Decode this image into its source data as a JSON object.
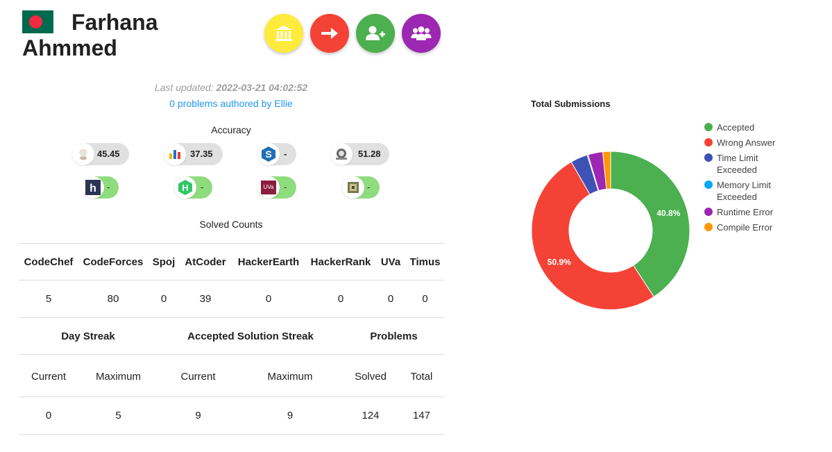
{
  "profile": {
    "first_name": "Farhana",
    "last_name": "Ahmmed",
    "country_flag": "bangladesh-flag"
  },
  "actions": [
    {
      "name": "institution-button",
      "icon": "institution-icon",
      "color": "#ffeb3b"
    },
    {
      "name": "arrow-right-button",
      "icon": "arrow-right-icon",
      "color": "#f44336"
    },
    {
      "name": "add-friend-button",
      "icon": "user-plus-icon",
      "color": "#4caf50"
    },
    {
      "name": "group-button",
      "icon": "users-icon",
      "color": "#9c27b0"
    }
  ],
  "meta": {
    "last_updated_label": "Last updated:",
    "last_updated_value": "2022-03-21 04:02:52",
    "authored_text": "0 problems authored by Ellie"
  },
  "accuracy": {
    "title": "Accuracy",
    "items": [
      {
        "site": "codechef",
        "icon": "codechef-logo-icon",
        "value": "45.45"
      },
      {
        "site": "codeforces",
        "icon": "codeforces-logo-icon",
        "value": "37.35"
      },
      {
        "site": "spoj",
        "icon": "spoj-logo-icon",
        "value": "-"
      },
      {
        "site": "atcoder",
        "icon": "atcoder-logo-icon",
        "value": "51.28"
      },
      {
        "site": "hackerearth",
        "icon": "hackerearth-logo-icon",
        "value": "-"
      },
      {
        "site": "hackerrank",
        "icon": "hackerrank-logo-icon",
        "value": "-"
      },
      {
        "site": "uva",
        "icon": "uva-logo-icon",
        "logo_text": "UVa",
        "value": "-"
      },
      {
        "site": "timus",
        "icon": "timus-logo-icon",
        "value": "-"
      }
    ]
  },
  "solved_counts": {
    "title": "Solved Counts",
    "headers": [
      "CodeChef",
      "CodeForces",
      "Spoj",
      "AtCoder",
      "HackerEarth",
      "HackerRank",
      "UVa",
      "Timus"
    ],
    "values": [
      "5",
      "80",
      "0",
      "39",
      "0",
      "0",
      "0",
      "0"
    ]
  },
  "streaks": {
    "groups": [
      "Day Streak",
      "Accepted Solution Streak",
      "Problems"
    ],
    "subheaders": [
      "Current",
      "Maximum",
      "Current",
      "Maximum",
      "Solved",
      "Total"
    ],
    "values": [
      "0",
      "5",
      "9",
      "9",
      "124",
      "147"
    ]
  },
  "chart_data": {
    "type": "pie",
    "title": "Total Submissions",
    "donut": true,
    "categories": [
      "Accepted",
      "Wrong Answer",
      "Time Limit Exceeded",
      "Memory Limit Exceeded",
      "Runtime Error",
      "Compile Error"
    ],
    "values": [
      40.8,
      50.9,
      3.5,
      0.2,
      3.0,
      1.6
    ],
    "data_labels": [
      "40.8%",
      "50.9%",
      "",
      "",
      "",
      ""
    ],
    "colors": [
      "#4caf50",
      "#f44336",
      "#3f51b5",
      "#03a9f4",
      "#9c27b0",
      "#ff9800"
    ],
    "legend_position": "right"
  }
}
